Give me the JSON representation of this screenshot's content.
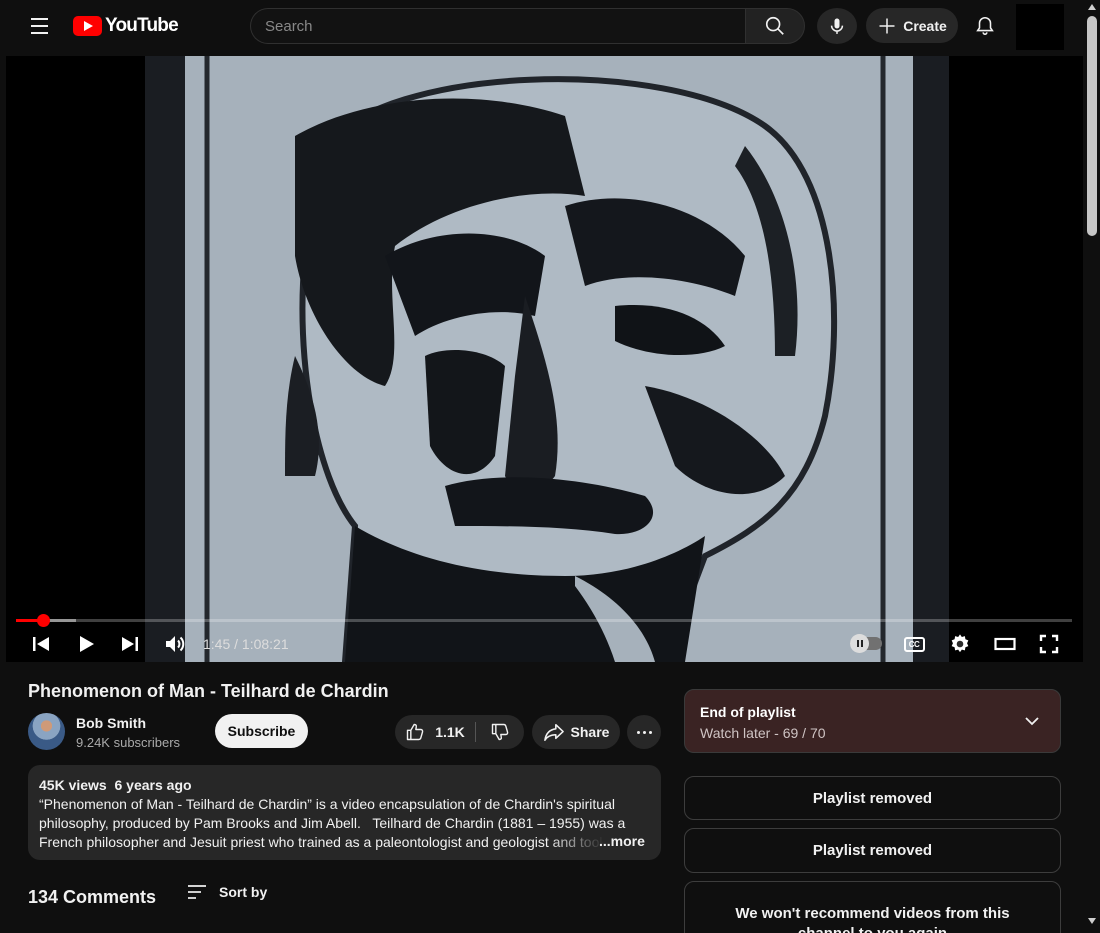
{
  "header": {
    "logo_text": "YouTube",
    "search_placeholder": "Search",
    "create_label": "Create",
    "brand_color": "#ff0000"
  },
  "player": {
    "time_current": "1:45",
    "time_sep": " / ",
    "time_total": "1:08:21",
    "progress_fraction": 0.0256,
    "buffered_fraction": 0.057,
    "progress_color": "#ff0000",
    "controls": [
      "previous-icon",
      "play-icon",
      "next-icon",
      "volume-icon",
      "autoplay-toggle",
      "captions-icon",
      "settings-icon",
      "theater-icon",
      "fullscreen-icon"
    ],
    "cc_label": "CC"
  },
  "video": {
    "title": "Phenomenon of Man - Teilhard de Chardin",
    "channel_name": "Bob Smith",
    "subscribers": "9.24K subscribers",
    "subscribe_label": "Subscribe",
    "likes": "1.1K",
    "share_label": "Share"
  },
  "description": {
    "views": "45K views",
    "age": "6 years ago",
    "text": "“Phenomenon of Man - Teilhard de Chardin” is a video encapsulation of de Chardin's spiritual philosophy, produced by Pam Brooks and Jim Abell.   Teilhard de Chardin (1881 – 1955) was a French philosopher and Jesuit priest who trained as a paleontologist and geologist and took",
    "more_label": "...more"
  },
  "comments": {
    "count_label": "134 Comments",
    "sort_label": "Sort by"
  },
  "playlist": {
    "title": "End of playlist",
    "subtitle": "Watch later - 69 / 70",
    "panel_color": "#3a2323"
  },
  "notices": [
    "Playlist removed",
    "Playlist removed",
    "We won't recommend videos from this channel to you again"
  ]
}
